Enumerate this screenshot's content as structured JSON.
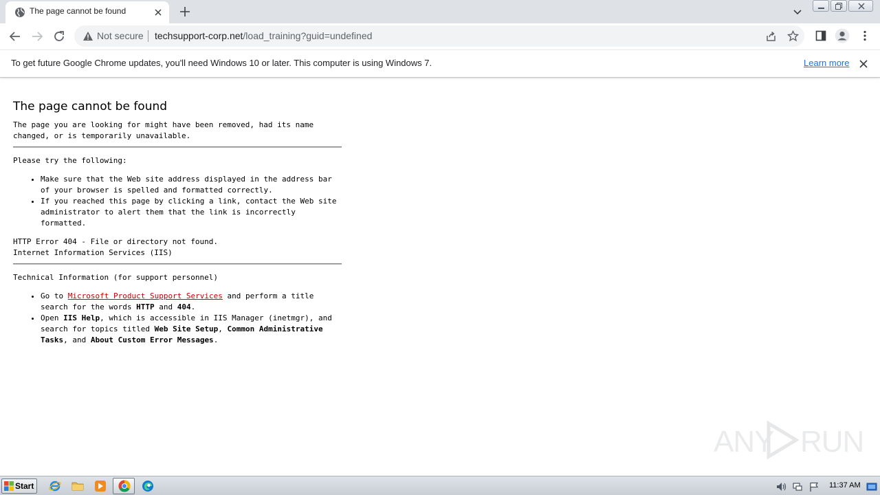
{
  "browser": {
    "tab": {
      "title": "The page cannot be found"
    },
    "address": {
      "security_label": "Not secure",
      "host": "techsupport-corp.net",
      "path": "/load_training?guid=undefined"
    },
    "infobar": {
      "message": "To get future Google Chrome updates, you'll need Windows 10 or later. This computer is using Windows 7.",
      "link": "Learn more"
    }
  },
  "page": {
    "heading": "The page cannot be found",
    "description": "The page you are looking for might have been removed, had its name changed, or is temporarily unavailable.",
    "try_heading": "Please try the following:",
    "try_items": [
      "Make sure that the Web site address displayed in the address bar of your browser is spelled and formatted correctly.",
      "If you reached this page by clicking a link, contact the Web site administrator to alert them that the link is incorrectly formatted."
    ],
    "http_error": "HTTP Error 404 - File or directory not found.",
    "server": "Internet Information Services (IIS)",
    "tech_heading": "Technical Information (for support personnel)",
    "tech_item1": {
      "prefix": "Go to ",
      "link": "Microsoft Product Support Services",
      "middle": " and perform a title search for the words ",
      "bold1": "HTTP",
      "and": " and ",
      "bold2": "404",
      "end": "."
    },
    "tech_item2": {
      "prefix": "Open ",
      "bold1": "IIS Help",
      "middle": ", which is accessible in IIS Manager (inetmgr), and search for topics titled ",
      "bold2": "Web Site Setup",
      "comma": ", ",
      "bold3": "Common Administrative Tasks",
      "and": ", and ",
      "bold4": "About Custom Error Messages",
      "end": "."
    }
  },
  "watermark": {
    "left": "ANY",
    "right": "RUN"
  },
  "taskbar": {
    "start_label": "Start",
    "clock": "11:37 AM"
  },
  "colors": {
    "link_red": "#cc0000",
    "chrome_link": "#1a73e8",
    "tabstrip": "#dee1e6"
  }
}
